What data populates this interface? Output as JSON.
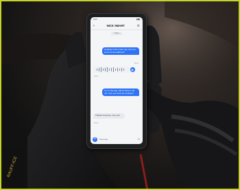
{
  "photo": {
    "description_colors": {
      "frame": "#c6d42a",
      "bubble": "#2f74f5",
      "glove": "#1b1b1d"
    },
    "brand_mark_on_glove": "RAUFF-ICE"
  },
  "chat": {
    "contact_name": "NICK SMART",
    "day_label": "Today",
    "messages": [
      {
        "side": "out",
        "text": "Heading to the route now, can you send me the address?"
      },
      {
        "side": "out",
        "text": "I'm on the way, will be there in 10 min. Can you send the location?"
      },
      {
        "side": "in",
        "text": "Thanks everyone, see you!"
      }
    ],
    "timestamps": [
      "09:41",
      "09:42",
      "09:43"
    ],
    "composer_placeholder": "Message"
  },
  "icons": {
    "back": "chevron-left-icon",
    "settings": "gear-icon",
    "play": "play-icon",
    "add": "plus-icon",
    "emoji": "smile-icon"
  }
}
